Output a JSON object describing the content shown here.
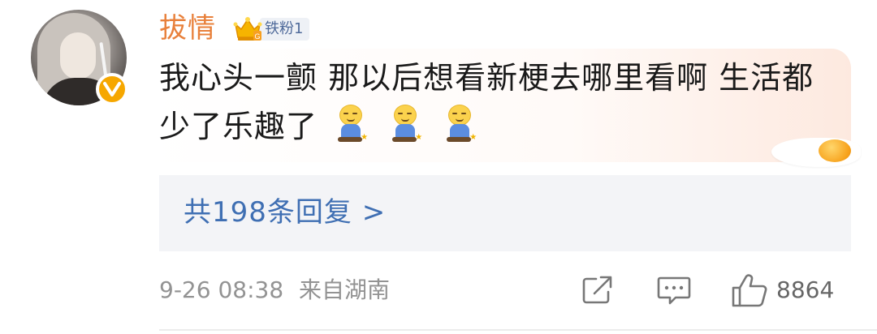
{
  "user": {
    "name": "拔情",
    "fan_badge": "铁粉1",
    "verified_icon": "verified-v-icon"
  },
  "comment": {
    "text": "我心头一颤 那以后想看新梗去哪里看啊 生活都少了乐趣了",
    "emojis": [
      "emoji-kneel",
      "emoji-kneel",
      "emoji-kneel"
    ]
  },
  "replies": {
    "label": "共198条回复 >"
  },
  "footer": {
    "date": "9-26 08:38",
    "location": "来自湖南",
    "likes": "8864",
    "icons": [
      "share-icon",
      "comment-icon",
      "thumbs-up-icon"
    ]
  },
  "colors": {
    "username": "#e8803b",
    "link": "#3f6fb3",
    "meta": "#939393",
    "badge_text": "#4f6a9a"
  }
}
